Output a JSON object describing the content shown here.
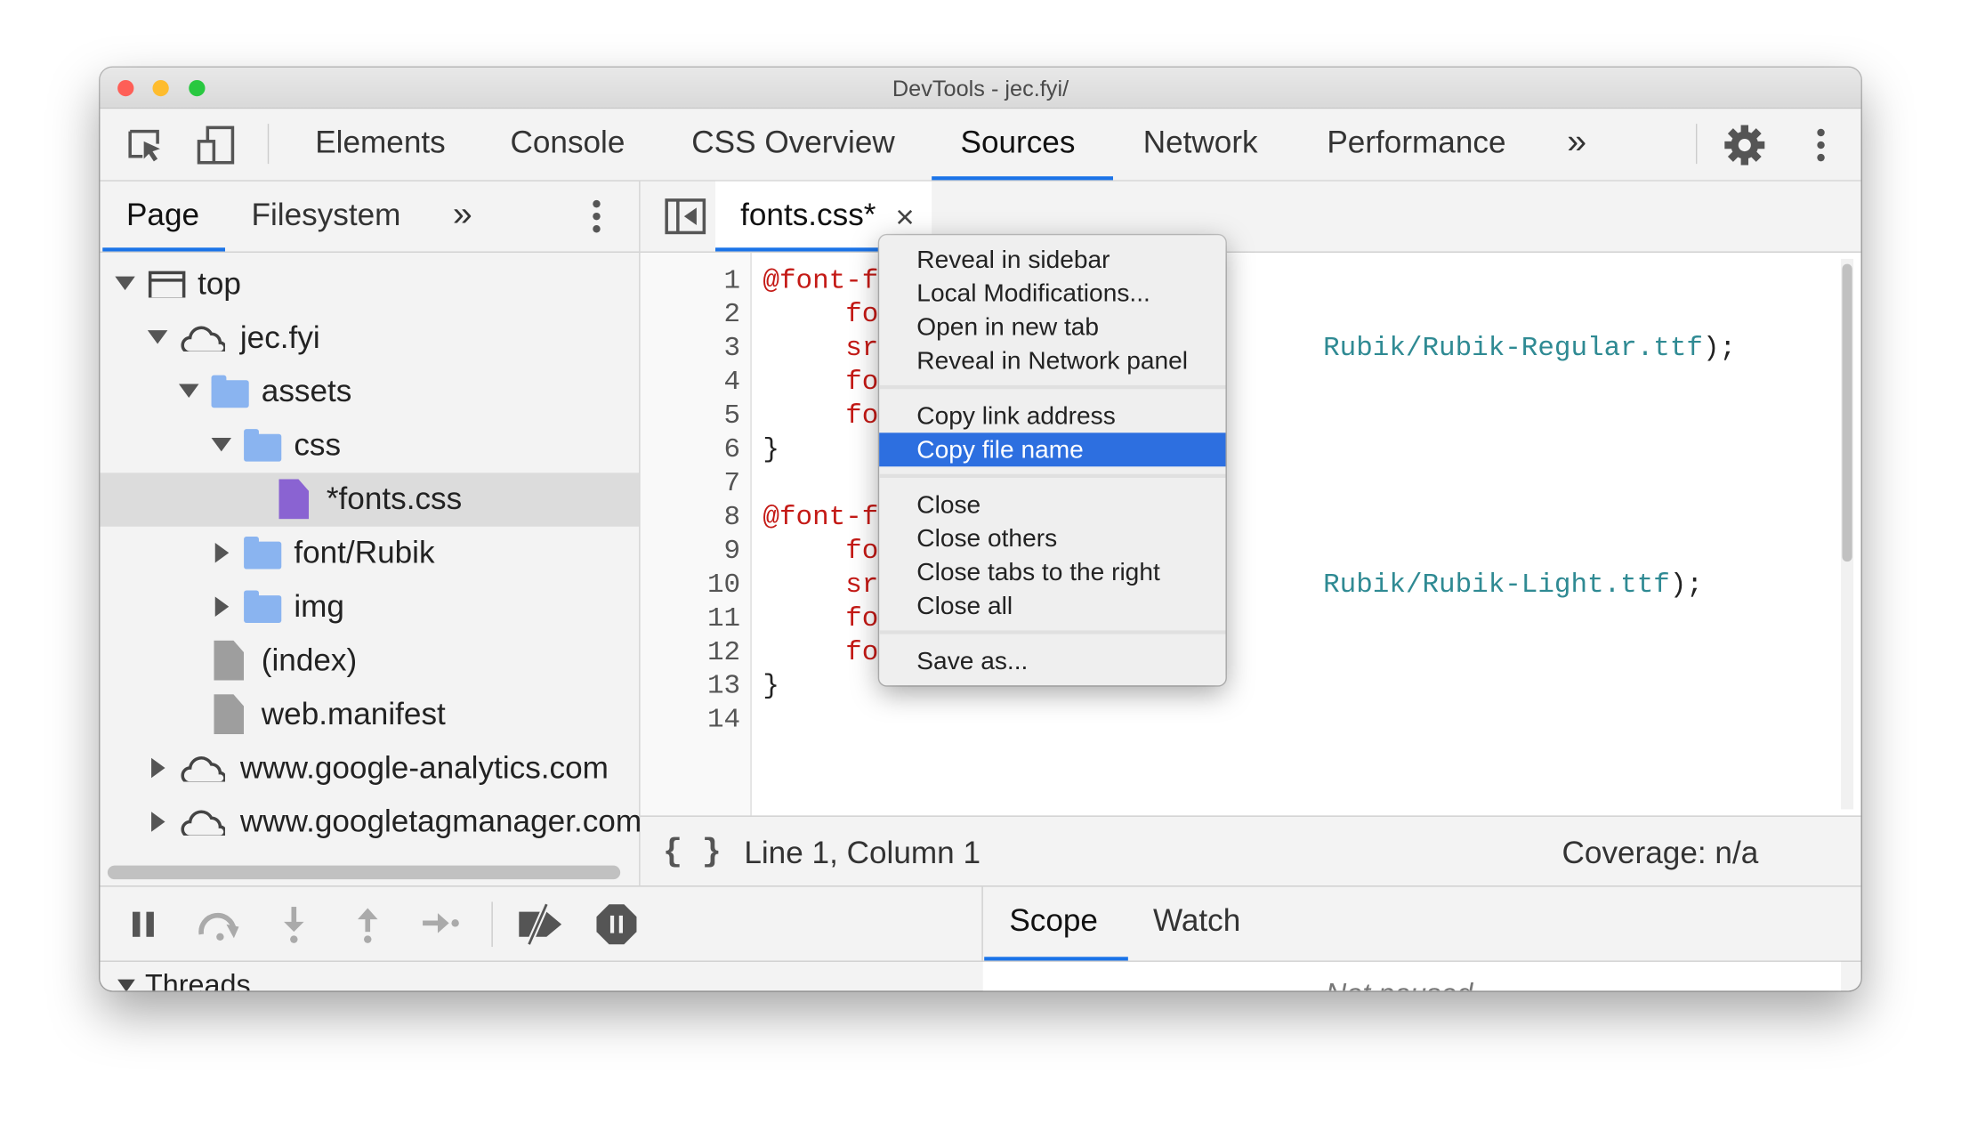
{
  "window": {
    "title": "DevTools - jec.fyi/",
    "traffic_lights": [
      "#fe5f57",
      "#febc2e",
      "#28c840"
    ]
  },
  "toolbar": {
    "tabs": [
      "Elements",
      "Console",
      "CSS Overview",
      "Sources",
      "Network",
      "Performance"
    ],
    "selected": "Sources",
    "more": "»",
    "accent": "#1a73e8"
  },
  "navigator": {
    "tabs": [
      "Page",
      "Filesystem"
    ],
    "selected": "Page",
    "more": "»",
    "tree": [
      {
        "label": "top",
        "depth": 0,
        "icon": "frame-icon",
        "expanded": true
      },
      {
        "label": "jec.fyi",
        "depth": 1,
        "icon": "cloud-icon",
        "expanded": true
      },
      {
        "label": "assets",
        "depth": 2,
        "icon": "folder-icon",
        "expanded": true
      },
      {
        "label": "css",
        "depth": 3,
        "icon": "folder-icon",
        "expanded": true
      },
      {
        "label": "*fonts.css",
        "depth": 4,
        "icon": "file-icon",
        "selected": true
      },
      {
        "label": "font/Rubik",
        "depth": 3,
        "icon": "folder-icon",
        "expanded": false
      },
      {
        "label": "img",
        "depth": 3,
        "icon": "folder-icon",
        "expanded": false
      },
      {
        "label": "(index)",
        "depth": 2,
        "icon": "file-icon"
      },
      {
        "label": "web.manifest",
        "depth": 2,
        "icon": "file-icon"
      },
      {
        "label": "www.google-analytics.com",
        "depth": 1,
        "icon": "cloud-icon",
        "expanded": false
      },
      {
        "label": "www.googletagmanager.com",
        "depth": 1,
        "icon": "cloud-icon",
        "expanded": false
      }
    ]
  },
  "editor": {
    "tab": "fonts.css*",
    "close": "×",
    "lines": [
      {
        "n": "1",
        "a": "@font-f",
        "b": ""
      },
      {
        "n": "2",
        "a": "     for",
        "b": ""
      },
      {
        "n": "3",
        "a": "     src",
        "b": "Rubik/Rubik-Regular.ttf",
        "c": ");"
      },
      {
        "n": "4",
        "a": "     for",
        "b": ""
      },
      {
        "n": "5",
        "a": "     for",
        "b": ""
      },
      {
        "n": "6",
        "a": "}",
        "b": ""
      },
      {
        "n": "7",
        "a": "",
        "b": ""
      },
      {
        "n": "8",
        "a": "@font-f",
        "b": ""
      },
      {
        "n": "9",
        "a": "     for",
        "b": ""
      },
      {
        "n": "10",
        "a": "     src",
        "b": "Rubik/Rubik-Light.ttf",
        "c": ");"
      },
      {
        "n": "11",
        "a": "     for",
        "b": ""
      },
      {
        "n": "12",
        "a": "     for",
        "b": ""
      },
      {
        "n": "13",
        "a": "}",
        "b": ""
      },
      {
        "n": "14",
        "a": "",
        "b": ""
      }
    ]
  },
  "status": {
    "format": "{ }",
    "position": "Line 1, Column 1",
    "coverage": "Coverage: n/a"
  },
  "debugger": {
    "tabs": [
      "Scope",
      "Watch"
    ],
    "selected": "Scope",
    "threads": "Threads",
    "scope_message": "Not paused"
  },
  "context_menu": {
    "groups": [
      [
        "Reveal in sidebar",
        "Local Modifications...",
        "Open in new tab",
        "Reveal in Network panel"
      ],
      [
        "Copy link address",
        "Copy file name"
      ],
      [
        "Close",
        "Close others",
        "Close tabs to the right",
        "Close all"
      ],
      [
        "Save as..."
      ]
    ],
    "highlighted": "Copy file name",
    "highlight_color": "#2d6fe0"
  }
}
